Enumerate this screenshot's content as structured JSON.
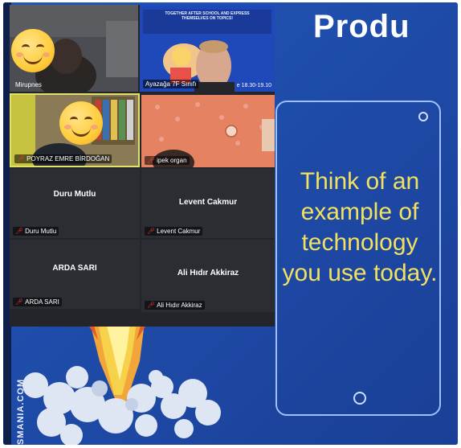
{
  "slide": {
    "heading": "Produ",
    "phone_text_lines": [
      "Think of an",
      "example of",
      "technology",
      "you use today."
    ],
    "side_text": "SMANIA.COM"
  },
  "gallery": {
    "participants": [
      {
        "name": "Mirupnes",
        "video": true,
        "muted": false,
        "face_covered": true
      },
      {
        "name": "Ayazağa 7F Sınıfı",
        "video": true,
        "muted": false,
        "face_covered": false,
        "shared_banner": "TOGETHER AFTER SCHOOL AND EXPRESS THEMSELVES ON TOPICS!",
        "shared_caption": "e 18.30-19.10"
      },
      {
        "name": "POYRAZ EMRE BİRDOĞAN",
        "video": true,
        "muted": true,
        "face_covered": true,
        "active_speaker": true
      },
      {
        "name": "ipek organ",
        "video": true,
        "muted": true,
        "face_covered": false
      },
      {
        "name": "Duru Mutlu",
        "display": "Duru Mutlu",
        "video": false,
        "muted": true
      },
      {
        "name": "Levent Cakmur",
        "display": "Levent Cakmur",
        "video": false,
        "muted": true
      },
      {
        "name": "ARDA SARI",
        "display": "ARDA SARI",
        "video": false,
        "muted": true
      },
      {
        "name": "Ali Hıdır Akkiraz",
        "display": "Ali Hıdır Akkiraz",
        "video": false,
        "muted": true
      }
    ]
  },
  "colors": {
    "slide_blue": "#1b4ba8",
    "phone_text": "#f2e160",
    "active_speaker_border": "#e0e36a",
    "muted_icon": "#ff3b30"
  },
  "icons": [
    "microphone-muted-icon",
    "smiley-face-icon"
  ]
}
